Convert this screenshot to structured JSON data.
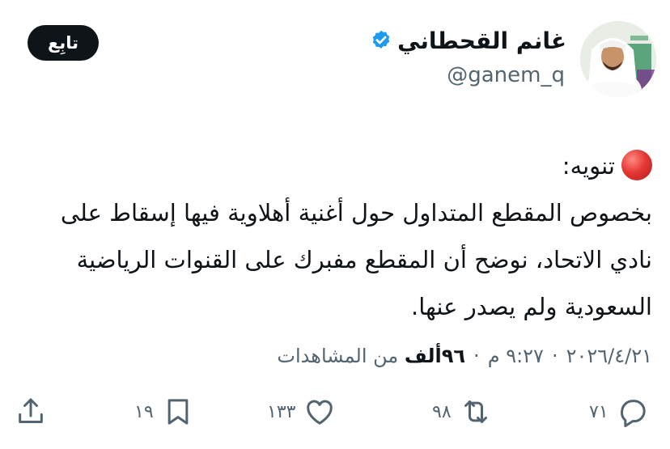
{
  "header": {
    "display_name": "غانم القحطاني",
    "handle": "@ganem_q",
    "follow_label": "تابِع",
    "verified": true,
    "verified_color": "#1d9bf0"
  },
  "tweet": {
    "line1": "تنويه:",
    "body": "بخصوص المقطع المتداول حول أغنية أهلاوية فيها إسقاط على نادي الاتحاد، نوضح أن المقطع مفبرك على القنوات الرياضية السعودية ولم يصدر عنها.",
    "alert_icon": "red-circle-icon"
  },
  "meta": {
    "time": "٩:٢٧ م",
    "date": "٢٠٢٦/٤/٢١",
    "views_count": "٩٦ألف",
    "views_label": "من المشاهدات",
    "separator": "·"
  },
  "actions": {
    "replies": "٧١",
    "retweets": "٩٨",
    "likes": "١٣٣",
    "bookmarks": "١٩"
  }
}
